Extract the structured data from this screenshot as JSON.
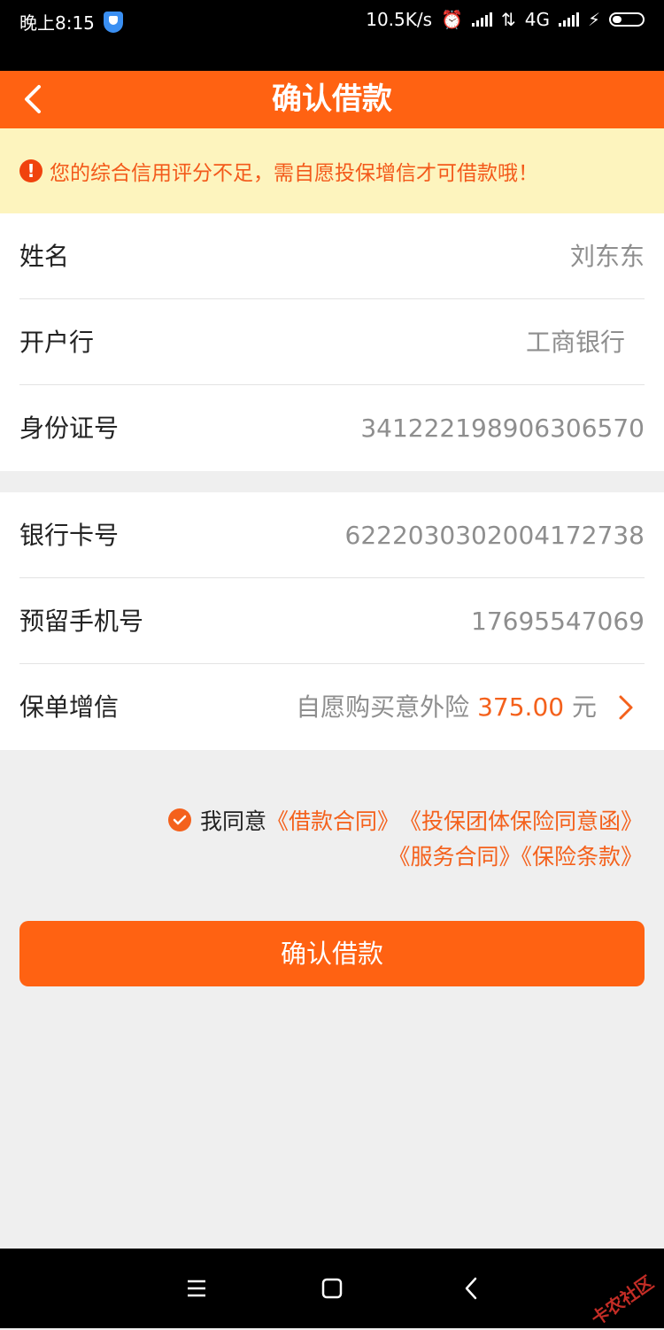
{
  "status_bar": {
    "time": "晚上8:15",
    "net_speed": "10.5K/s",
    "network": "4G"
  },
  "nav": {
    "title": "确认借款"
  },
  "notice": {
    "text": "您的综合信用评分不足，需自愿投保增信才可借款哦！"
  },
  "personal": [
    {
      "label": "姓名",
      "value": "刘东东"
    },
    {
      "label": "开户行",
      "value": "工商银行"
    },
    {
      "label": "身份证号",
      "value": "341222198906306570"
    }
  ],
  "bank": [
    {
      "label": "银行卡号",
      "value": "6222030302004172738"
    },
    {
      "label": "预留手机号",
      "value": "17695547069"
    },
    {
      "label": "保单增信",
      "value_prefix": "自愿购买意外险",
      "amount": "375.00",
      "unit": "元"
    }
  ],
  "agreement": {
    "prefix": "我同意",
    "doc1": "《借款合同》",
    "doc2": "《投保团体保险同意函》",
    "doc3": "《服务合同》",
    "doc4": "《保险条款》"
  },
  "confirm_button": "确认借款",
  "watermark": "卡农社区",
  "colors": {
    "brand": "#ff6212",
    "notice_bg": "#fdf4be",
    "notice_text": "#f3591a"
  }
}
